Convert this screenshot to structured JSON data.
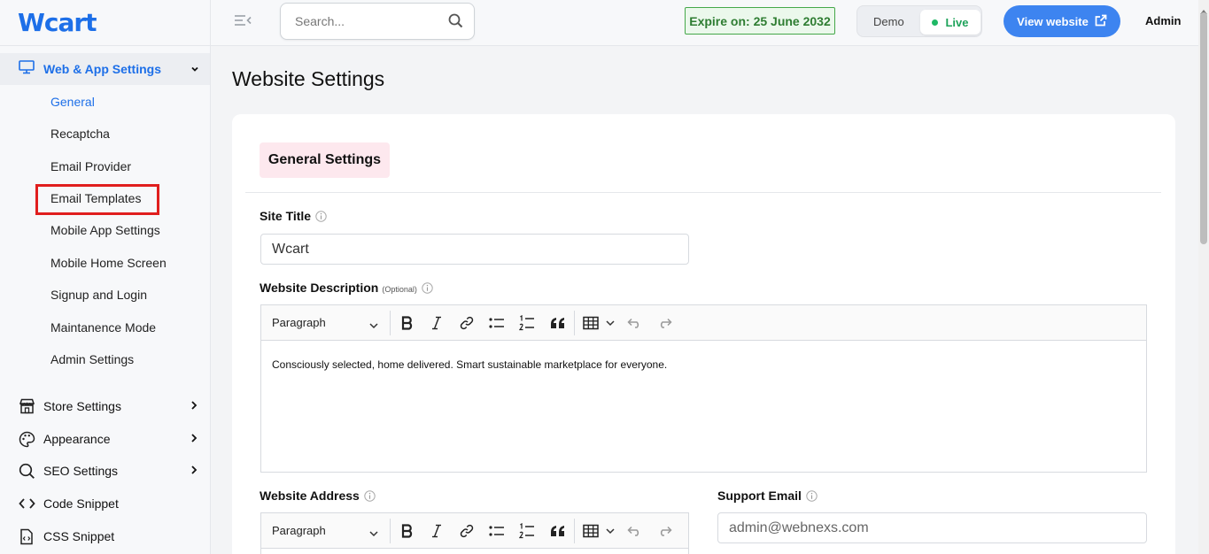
{
  "app": {
    "logo_text": "Wcart"
  },
  "search": {
    "placeholder": "Search..."
  },
  "topbar": {
    "expire": "Expire on: 25 June 2032",
    "env_demo": "Demo",
    "env_live": "Live",
    "view_website": "View website",
    "admin": "Admin"
  },
  "sidebar": {
    "active_group": "Web & App Settings",
    "sub_items": [
      "General",
      "Recaptcha",
      "Email Provider",
      "Email Templates",
      "Mobile App Settings",
      "Mobile Home Screen",
      "Signup and Login",
      "Maintanence Mode",
      "Admin Settings"
    ],
    "groups": [
      {
        "label": "Store Settings",
        "icon": "store-icon",
        "has_arrow": true
      },
      {
        "label": "Appearance",
        "icon": "palette-icon",
        "has_arrow": true
      },
      {
        "label": "SEO Settings",
        "icon": "search-icon",
        "has_arrow": true
      },
      {
        "label": "Code Snippet",
        "icon": "code-icon",
        "has_arrow": false
      },
      {
        "label": "CSS Snippet",
        "icon": "file-code-icon",
        "has_arrow": false
      }
    ]
  },
  "main": {
    "page_title": "Website Settings",
    "section_title": "General Settings",
    "site_title_label": "Site Title",
    "site_title_value": "Wcart",
    "description_label": "Website Description",
    "description_optional": "(Optional)",
    "editor_block_type": "Paragraph",
    "description_text": "Consciously selected, home delivered. Smart sustainable marketplace for everyone.",
    "address_label": "Website Address",
    "support_email_label": "Support Email",
    "support_email_placeholder": "admin@webnexs.com"
  },
  "colors": {
    "accent": "#1d6fe8",
    "button": "#3d84f0",
    "expire_green": "#2e7d32",
    "live_green": "#1fb866",
    "section_tag_bg": "#fde8ee",
    "highlight_red": "#e01e1e"
  }
}
